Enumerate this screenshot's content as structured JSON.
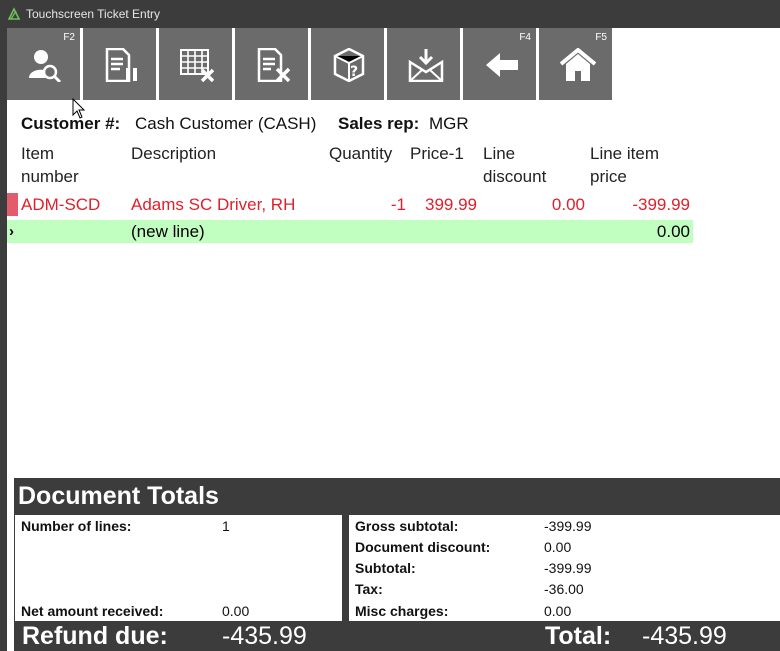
{
  "window": {
    "title": "Touchscreen Ticket Entry"
  },
  "toolbar": {
    "buttons": [
      {
        "name": "customer-lookup",
        "icon": "user-search-icon",
        "fkey": "F2"
      },
      {
        "name": "hold-ticket",
        "icon": "document-pause-icon",
        "fkey": ""
      },
      {
        "name": "void-line",
        "icon": "grid-delete-icon",
        "fkey": ""
      },
      {
        "name": "void-ticket",
        "icon": "document-delete-icon",
        "fkey": ""
      },
      {
        "name": "item-lookup",
        "icon": "box-question-icon",
        "fkey": ""
      },
      {
        "name": "receive-mail",
        "icon": "envelope-download-icon",
        "fkey": ""
      },
      {
        "name": "back",
        "icon": "arrow-left-icon",
        "fkey": "F4"
      },
      {
        "name": "home",
        "icon": "home-icon",
        "fkey": "F5"
      }
    ]
  },
  "customer": {
    "customer_label": "Customer #:",
    "customer_value": "Cash Customer (CASH)",
    "salesrep_label": "Sales rep:",
    "salesrep_value": "MGR"
  },
  "grid": {
    "headers": {
      "item_number_1": "Item",
      "item_number_2": "number",
      "description": "Description",
      "quantity": "Quantity",
      "price": "Price-1",
      "line_discount_1": "Line",
      "line_discount_2": "discount",
      "line_price_1": "Line item",
      "line_price_2": "price"
    },
    "rows": [
      {
        "item": "ADM-SCD",
        "description": "Adams SC Driver, RH",
        "quantity": "-1",
        "price": "399.99",
        "discount": "0.00",
        "line_price": "-399.99"
      }
    ],
    "new_line": {
      "marker": "›",
      "description": "(new line)",
      "line_price": "0.00"
    }
  },
  "totals": {
    "title": "Document Totals",
    "number_of_lines_label": "Number of lines:",
    "number_of_lines": "1",
    "net_received_label": "Net amount received:",
    "net_received": "0.00",
    "gross_subtotal_label": "Gross subtotal:",
    "gross_subtotal": "-399.99",
    "doc_discount_label": "Document discount:",
    "doc_discount": "0.00",
    "subtotal_label": "Subtotal:",
    "subtotal": "-399.99",
    "tax_label": "Tax:",
    "tax": "-36.00",
    "misc_label": "Misc charges:",
    "misc": "0.00",
    "refund_label": "Refund due:",
    "refund": "-435.99",
    "total_label": "Total:",
    "total": "-435.99"
  }
}
